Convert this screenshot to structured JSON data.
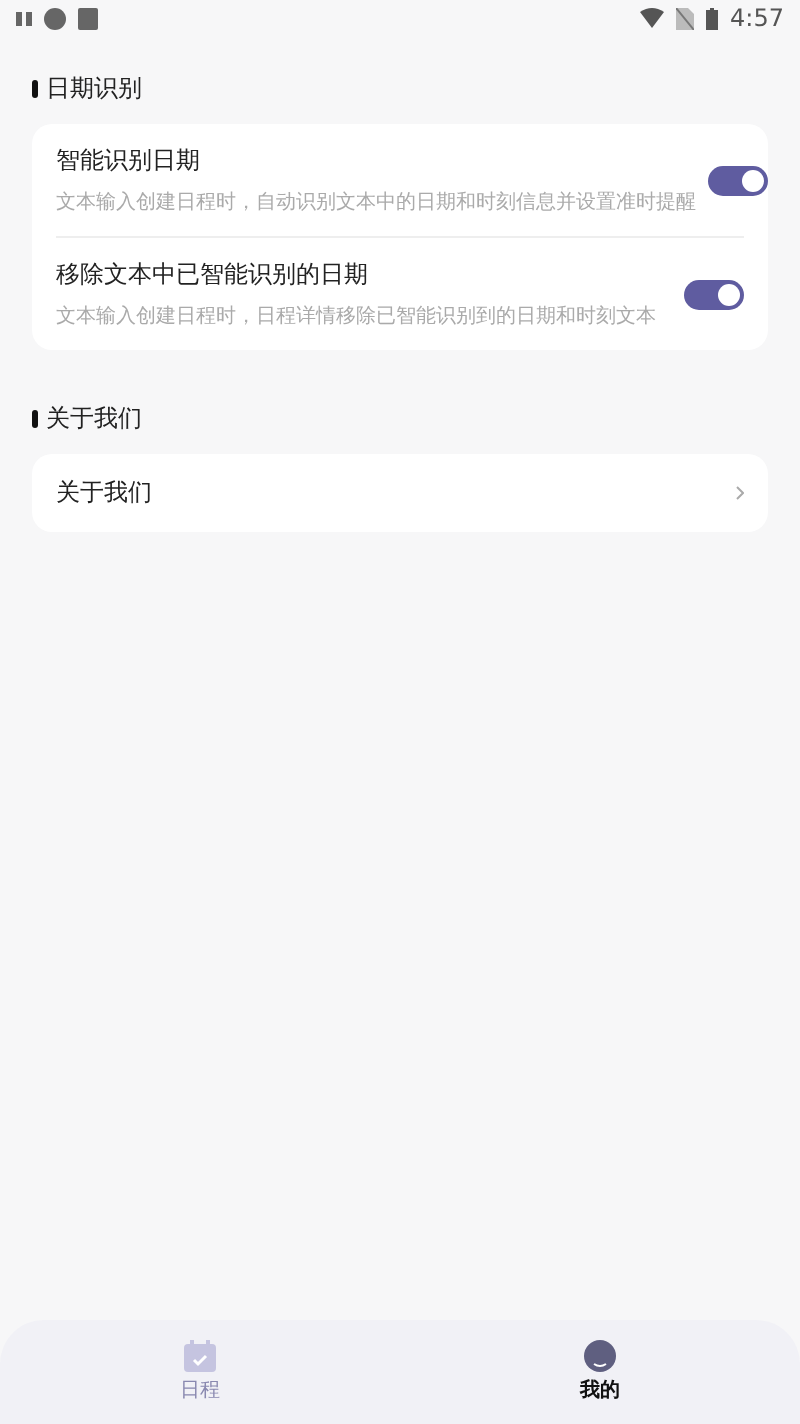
{
  "status_bar": {
    "time": "4:57"
  },
  "sections": [
    {
      "title": "日期识别",
      "items": [
        {
          "kind": "toggle",
          "label": "智能识别日期",
          "description": "文本输入创建日程时，自动识别文本中的日期和时刻信息并设置准时提醒",
          "on": true
        },
        {
          "kind": "toggle",
          "label": "移除文本中已智能识别的日期",
          "description": "文本输入创建日程时，日程详情移除已智能识别到的日期和时刻文本",
          "on": true
        }
      ]
    },
    {
      "title": "关于我们",
      "items": [
        {
          "kind": "link",
          "label": "关于我们"
        }
      ]
    }
  ],
  "tabs": [
    {
      "label": "日程",
      "selected": false
    },
    {
      "label": "我的",
      "selected": true
    }
  ]
}
